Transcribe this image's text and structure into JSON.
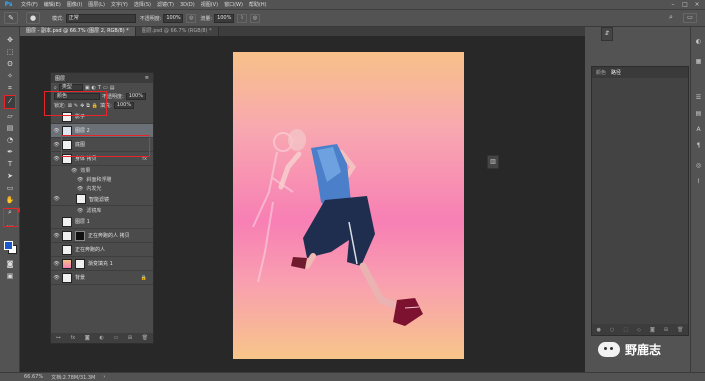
{
  "app": {
    "logo": "Ps"
  },
  "menu": [
    "文件(F)",
    "编辑(E)",
    "图像(I)",
    "图层(L)",
    "文字(Y)",
    "选择(S)",
    "滤镜(T)",
    "3D(D)",
    "视图(V)",
    "窗口(W)",
    "帮助(H)"
  ],
  "window_controls": [
    "–",
    "□",
    "×"
  ],
  "options": {
    "mode_label": "模式:",
    "mode_value": "正常",
    "opacity_label": "不透明度:",
    "opacity_value": "100%",
    "flow_label": "流量:",
    "flow_value": "100%"
  },
  "tabs": [
    "图层 - 副本.psd @ 66.7% (图层 2, RGB/8) *",
    "图层.psd @ 66.7% (RGB/8) *"
  ],
  "layers": {
    "tab": "图层",
    "filter": "类型",
    "blend": "颜色",
    "opacity_label": "不透明度:",
    "opacity_value": "100%",
    "lock_label": "锁定:",
    "fill_label": "填充:",
    "fill_value": "100%",
    "items": [
      {
        "name": "影子",
        "eye": "",
        "sel": false,
        "fx": ""
      },
      {
        "name": "图层 2",
        "eye": "👁",
        "sel": true,
        "fx": ""
      },
      {
        "name": "底图",
        "eye": "👁",
        "sel": false,
        "fx": ""
      },
      {
        "name": "身体 拷贝",
        "eye": "👁",
        "sel": false,
        "fx": "fx"
      }
    ],
    "effects": [
      "效果",
      "斜面和浮雕",
      "内发光"
    ],
    "smart_items": [
      {
        "name": "智能滤镜",
        "eye": "👁"
      },
      {
        "name": "滤镜库",
        "eye": "👁"
      }
    ],
    "items2": [
      {
        "name": "图层 1",
        "eye": "",
        "fx": ""
      },
      {
        "name": "正在奔跑的人 拷贝",
        "eye": "👁",
        "fx": ""
      },
      {
        "name": "正在奔跑的人",
        "eye": "",
        "fx": ""
      },
      {
        "name": "渐变填充 1",
        "eye": "👁",
        "fx": ""
      },
      {
        "name": "背景",
        "eye": "👁",
        "fx": ""
      }
    ]
  },
  "right_panel": {
    "tabs": [
      "颜色",
      "路径"
    ]
  },
  "status": {
    "zoom": "66.67%",
    "doc": "文档:2.78M/31.3M"
  },
  "watermark": "野鹿志"
}
